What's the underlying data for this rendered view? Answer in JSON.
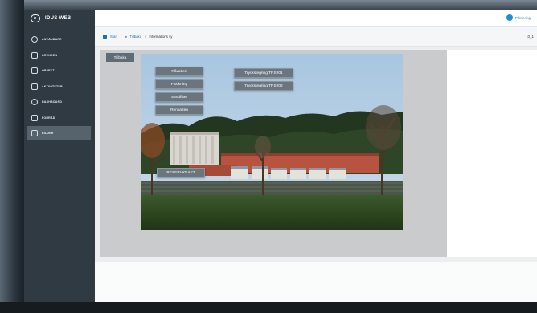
{
  "app": {
    "title": "IDUS WEB"
  },
  "sidebar": {
    "items": [
      {
        "label": "ANVÄNDARE",
        "icon": "user-icon"
      },
      {
        "label": "ÄRENDEN",
        "icon": "document-icon"
      },
      {
        "label": "OBJEKT",
        "icon": "object-icon"
      },
      {
        "label": "AKTIVITETER",
        "icon": "activity-icon"
      },
      {
        "label": "DASHBOARD",
        "icon": "dashboard-icon"
      },
      {
        "label": "FÖRRÅD",
        "icon": "storage-icon"
      },
      {
        "label": "BILDER",
        "icon": "image-icon",
        "active": true
      }
    ]
  },
  "topbar": {
    "user_name": "Planering"
  },
  "breadcrumb": {
    "start": "Start",
    "back": "Tillbaka",
    "current": "Informations sy",
    "tag": "[0_1"
  },
  "content": {
    "back_button": "Tillbaka",
    "hotspots": [
      "Råvatten",
      "Flockning",
      "Sandfilter",
      "Renvatten",
      "Tryckstegring TRS201",
      "Tryckstegring TRS202",
      "RESERVKRAFT"
    ]
  },
  "colors": {
    "sidebar": "#2f3a42",
    "sidebar_active": "#56636d",
    "accent": "#1d8fd8",
    "hotspot": "#6a757d"
  }
}
